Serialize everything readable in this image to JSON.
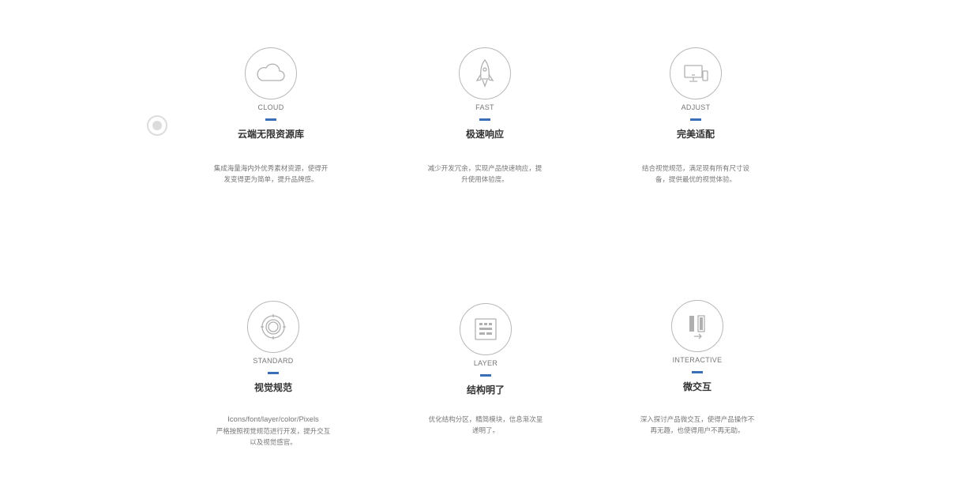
{
  "features": [
    {
      "tag": "CLOUD",
      "title": "云端无限资源库",
      "desc_line1": "集成海量海内外优秀素材资源，使得开",
      "desc_line2": "发变得更为简单，提升品牌感。",
      "icon": "cloud-icon"
    },
    {
      "tag": "FAST",
      "title": "极速响应",
      "desc_line1": "减少开发冗余，实现产品快速响应，提",
      "desc_line2": "升使用体验度。",
      "icon": "rocket-icon"
    },
    {
      "tag": "ADJUST",
      "title": "完美适配",
      "desc_line1": "结合视觉规范，满足现有所有尺寸设",
      "desc_line2": "备，提供最优的视觉体验。",
      "icon": "devices-icon"
    },
    {
      "tag": "STANDARD",
      "title": "视觉规范",
      "desc_line1": "Icons/font/layer/color/Pixels",
      "desc_line2": "严格按照视觉规范进行开发，提升交互",
      "desc_line3": "以及视觉感官。",
      "icon": "target-icon"
    },
    {
      "tag": "LAYER",
      "title": "结构明了",
      "desc_line1": "优化结构分区，精简模块，信息渐次呈",
      "desc_line2": "递明了。",
      "icon": "layout-icon"
    },
    {
      "tag": "INTERACTIVE",
      "title": "微交互",
      "desc_line1": "深入探讨产品微交互，使得产品操作不",
      "desc_line2": "再无趣，也使得用户不再无助。",
      "icon": "interaction-icon"
    }
  ],
  "colors": {
    "accent": "#3a6fb8",
    "icon_stroke": "#b8b8b8",
    "title": "#333333",
    "desc": "#777777"
  }
}
